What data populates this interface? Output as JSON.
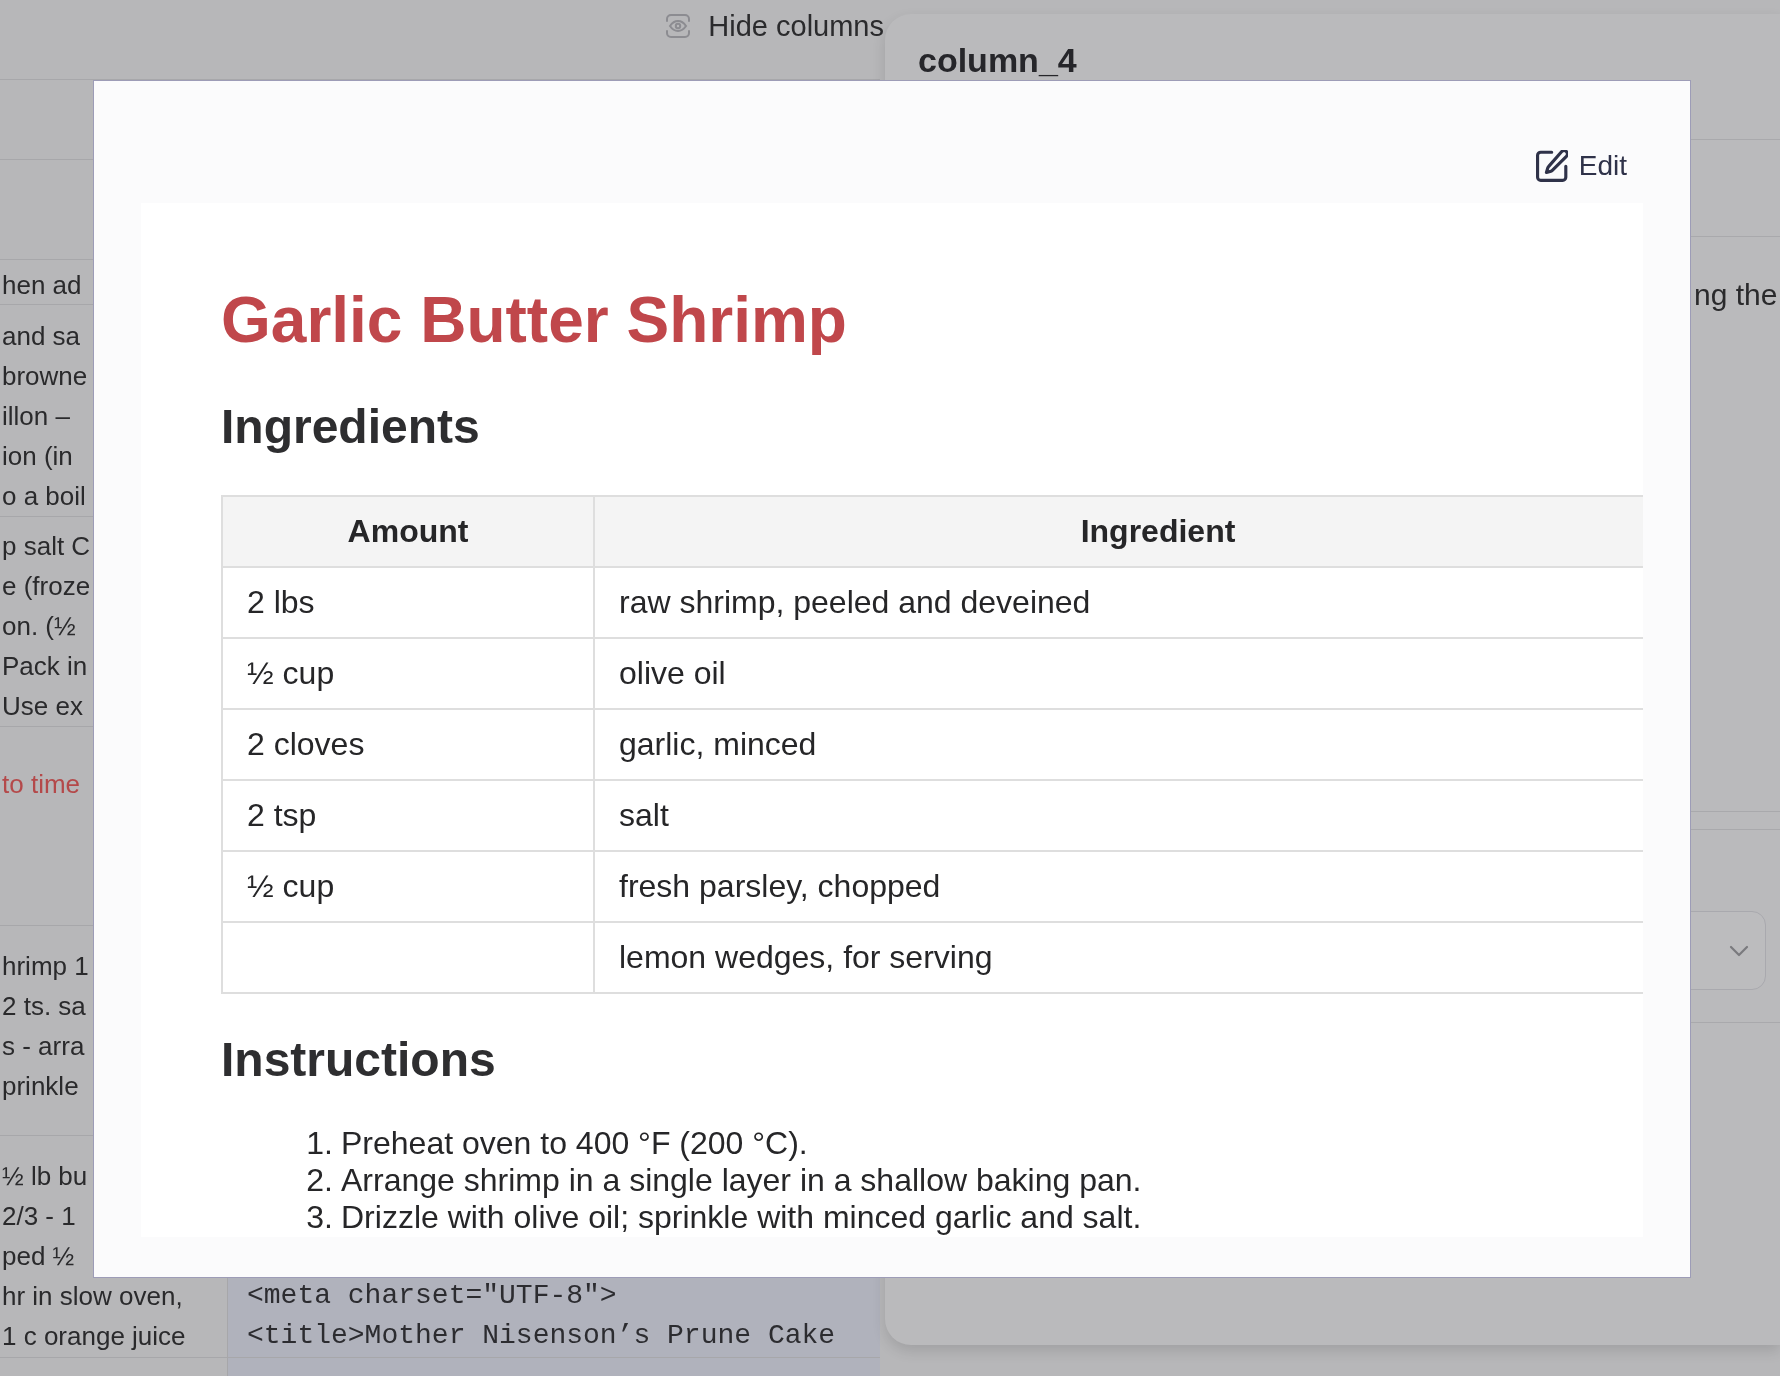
{
  "toolbar": {
    "hide_columns": "Hide columns"
  },
  "background_table": {
    "rows": [
      {
        "column_1": {
          "kind": "text",
          "lines": [
            "hen ad"
          ]
        }
      },
      {
        "column_1": {
          "kind": "text",
          "lines": [
            "and sa",
            "browne",
            "illon –",
            "ion (in",
            "o a boil"
          ]
        }
      },
      {
        "column_1": {
          "kind": "text",
          "lines": [
            "p salt C",
            "e (froze",
            "on. (½",
            "Pack in",
            "Use ex"
          ]
        }
      },
      {
        "column_1": {
          "kind": "error",
          "lines": [
            "to time"
          ]
        }
      },
      {
        "column_1": {
          "kind": "text",
          "lines": [
            "hrimp 1",
            "2 ts. sa",
            "s - arra",
            "prinkle"
          ]
        }
      },
      {
        "column_1": {
          "kind": "text",
          "lines": [
            "½ lb bu",
            "2/3 - 1",
            "ped ½",
            "hr in slow oven,",
            "1 c orange juice"
          ]
        },
        "column_2": {
          "kind": "code",
          "lines": [
            "<meta charset=\"UTF-8\">",
            "<title>Mother Nisenson’s Prune Cake"
          ]
        }
      }
    ]
  },
  "side_panel": {
    "heading": "column_4",
    "text": "ng the"
  },
  "modal": {
    "edit_button": "Edit",
    "recipe": {
      "title": "Garlic Butter Shrimp",
      "sections": [
        {
          "kind": "table",
          "heading": "Ingredients",
          "columns": [
            "Amount",
            "Ingredient"
          ],
          "rows": [
            {
              "amount": "2 lbs",
              "ingredient": "raw shrimp, peeled and deveined"
            },
            {
              "amount": "½ cup",
              "ingredient": "olive oil"
            },
            {
              "amount": "2 cloves",
              "ingredient": "garlic, minced"
            },
            {
              "amount": "2 tsp",
              "ingredient": "salt"
            },
            {
              "amount": "½ cup",
              "ingredient": "fresh parsley, chopped"
            },
            {
              "ingredient": "lemon wedges, for serving"
            }
          ]
        },
        {
          "kind": "ordered_list",
          "heading": "Instructions",
          "items": [
            {
              "number": "1.",
              "text": "Preheat oven to 400 °F (200 °C)."
            },
            {
              "number": "2.",
              "text": "Arrange shrimp in a single layer in a shallow baking pan."
            },
            {
              "number": "3.",
              "text": "Drizzle with olive oil; sprinkle with minced garlic and salt."
            }
          ]
        }
      ]
    }
  }
}
